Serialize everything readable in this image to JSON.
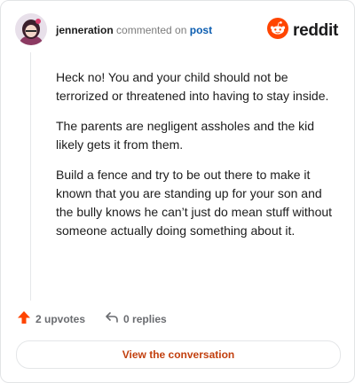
{
  "header": {
    "username": "jenneration",
    "commented_on": "commented on",
    "post_link": "post",
    "brand": "reddit"
  },
  "comment": {
    "paragraphs": [
      "Heck no! You and your child should not be terrorized or threatened into having to stay inside.",
      "The parents are negligent assholes and the kid likely gets it from them.",
      "Build a fence and try to be out there to make it known that you are standing up for your son and the bully knows he can’t just do mean stuff without someone actually doing something about it."
    ]
  },
  "actions": {
    "upvotes": "2 upvotes",
    "replies": "0 replies"
  },
  "cta": {
    "label": "View the conversation"
  },
  "colors": {
    "brand_orange": "#ff4500",
    "link_blue": "#0a5cb0",
    "cta_text": "#c2400f"
  },
  "icons": {
    "upvote": "arrow-up-icon",
    "reply": "reply-arrow-icon",
    "brand": "reddit-snoo-icon"
  }
}
